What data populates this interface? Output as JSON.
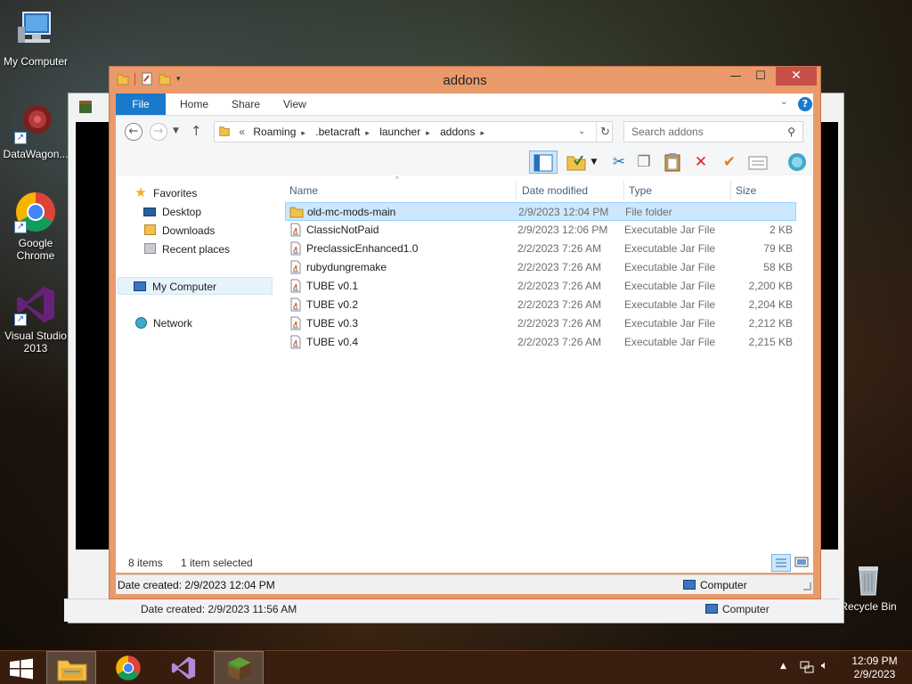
{
  "desktop": {
    "icons": [
      {
        "label": "My Computer"
      },
      {
        "label": "DataWagon..."
      },
      {
        "label": "Google Chrome"
      },
      {
        "label": "Visual Studio 2013"
      },
      {
        "label": "Recycle Bin"
      }
    ]
  },
  "back_window": {
    "status_left": "Date created: 2/9/2023 11:56 AM",
    "status_right": "Computer"
  },
  "window": {
    "title": "addons",
    "ribbon_tabs": [
      "File",
      "Home",
      "Share",
      "View"
    ],
    "address": {
      "prefix": "«",
      "crumbs": [
        "Roaming",
        ".betacraft",
        "launcher",
        "addons"
      ]
    },
    "search_placeholder": "Search addons",
    "nav": {
      "favorites": "Favorites",
      "desktop": "Desktop",
      "downloads": "Downloads",
      "recent": "Recent places",
      "computer": "My Computer",
      "network": "Network"
    },
    "columns": {
      "name": "Name",
      "date": "Date modified",
      "type": "Type",
      "size": "Size"
    },
    "files": [
      {
        "name": "old-mc-mods-main",
        "date": "2/9/2023 12:04 PM",
        "type": "File folder",
        "size": "",
        "icon": "folder-icon"
      },
      {
        "name": "ClassicNotPaid",
        "date": "2/9/2023 12:06 PM",
        "type": "Executable Jar File",
        "size": "2 KB",
        "icon": "jar-file-icon"
      },
      {
        "name": "PreclassicEnhanced1.0",
        "date": "2/2/2023 7:26 AM",
        "type": "Executable Jar File",
        "size": "79 KB",
        "icon": "jar-file-icon"
      },
      {
        "name": "rubydungremake",
        "date": "2/2/2023 7:26 AM",
        "type": "Executable Jar File",
        "size": "58 KB",
        "icon": "jar-file-icon"
      },
      {
        "name": "TUBE v0.1",
        "date": "2/2/2023 7:26 AM",
        "type": "Executable Jar File",
        "size": "2,200 KB",
        "icon": "jar-file-icon"
      },
      {
        "name": "TUBE v0.2",
        "date": "2/2/2023 7:26 AM",
        "type": "Executable Jar File",
        "size": "2,204 KB",
        "icon": "jar-file-icon"
      },
      {
        "name": "TUBE v0.3",
        "date": "2/2/2023 7:26 AM",
        "type": "Executable Jar File",
        "size": "2,212 KB",
        "icon": "jar-file-icon"
      },
      {
        "name": "TUBE v0.4",
        "date": "2/2/2023 7:26 AM",
        "type": "Executable Jar File",
        "size": "2,215 KB",
        "icon": "jar-file-icon"
      }
    ],
    "status": {
      "count": "8 items",
      "selected": "1 item selected"
    },
    "details": {
      "created": "Date created: 2/9/2023 12:04 PM",
      "location": "Computer"
    }
  },
  "taskbar": {
    "time": "12:09 PM",
    "date": "2/9/2023"
  },
  "colors": {
    "title_bar": "#ea9a6a",
    "file_tab": "#1979ca",
    "close_button": "#c7504a",
    "selection": "#cce8ff"
  }
}
